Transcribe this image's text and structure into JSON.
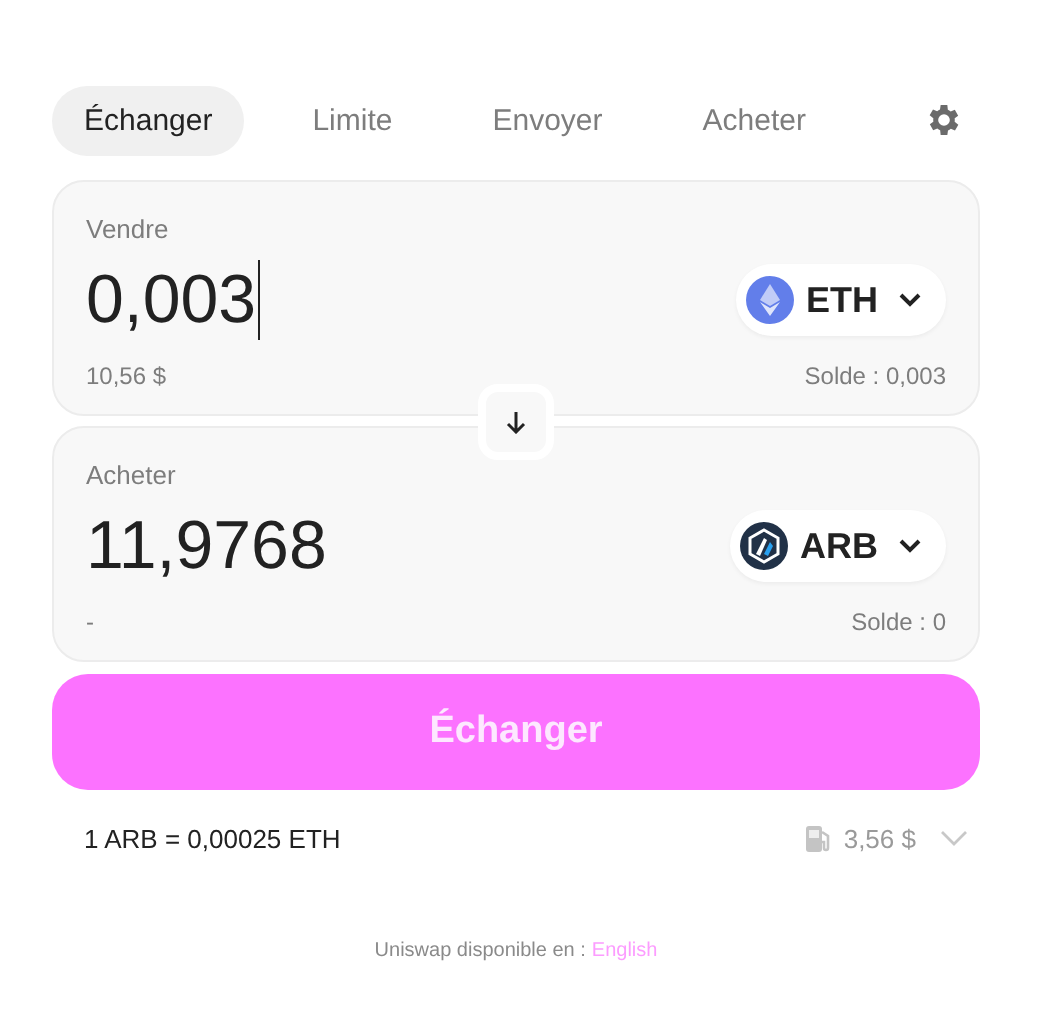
{
  "tabs": [
    {
      "label": "Échanger",
      "selected": true
    },
    {
      "label": "Limite",
      "selected": false
    },
    {
      "label": "Envoyer",
      "selected": false
    },
    {
      "label": "Acheter",
      "selected": false
    }
  ],
  "panels": [
    {
      "label": "Vendre",
      "amount": "0,003",
      "focused": true,
      "token": {
        "symbol": "ETH",
        "kind": "eth"
      },
      "fiat": "10,56 $",
      "balance": "Solde : 0,003"
    },
    {
      "label": "Acheter",
      "amount": "11,9768",
      "focused": false,
      "token": {
        "symbol": "ARB",
        "kind": "arb"
      },
      "fiat": "-",
      "balance": "Solde : 0"
    }
  ],
  "swap_button": "Échanger",
  "rate": "1 ARB = 0,00025 ETH",
  "gas_fee": "3,56 $",
  "footer": {
    "text": "Uniswap disponible en :",
    "link": "English"
  }
}
